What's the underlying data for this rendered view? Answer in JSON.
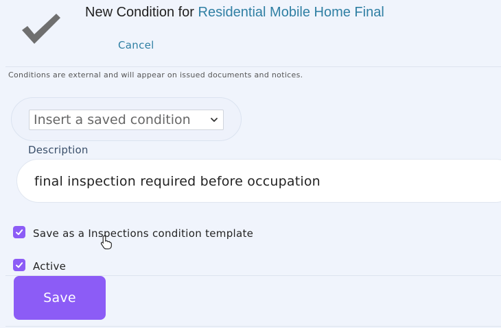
{
  "header": {
    "title_prefix": "New Condition for",
    "project_name": "Residential Mobile Home Final",
    "cancel_label": "Cancel"
  },
  "note": "Conditions are external and will appear on issued documents and notices.",
  "saved_condition": {
    "selected": "Insert a saved condition"
  },
  "description": {
    "label": "Description",
    "value": "final inspection required before occupation"
  },
  "options": {
    "save_template": {
      "label": "Save as a Inspections condition template",
      "checked": true
    },
    "active": {
      "label": "Active",
      "checked": true
    }
  },
  "actions": {
    "save_label": "Save"
  },
  "colors": {
    "accent": "#8c5cf6",
    "link": "#2f7fa3",
    "background": "#f0f4fc"
  },
  "icons": {
    "logo": "checkmark-icon",
    "dropdown": "chevron-down-icon",
    "checkbox": "check-icon",
    "cursor": "hand-pointer-icon"
  }
}
